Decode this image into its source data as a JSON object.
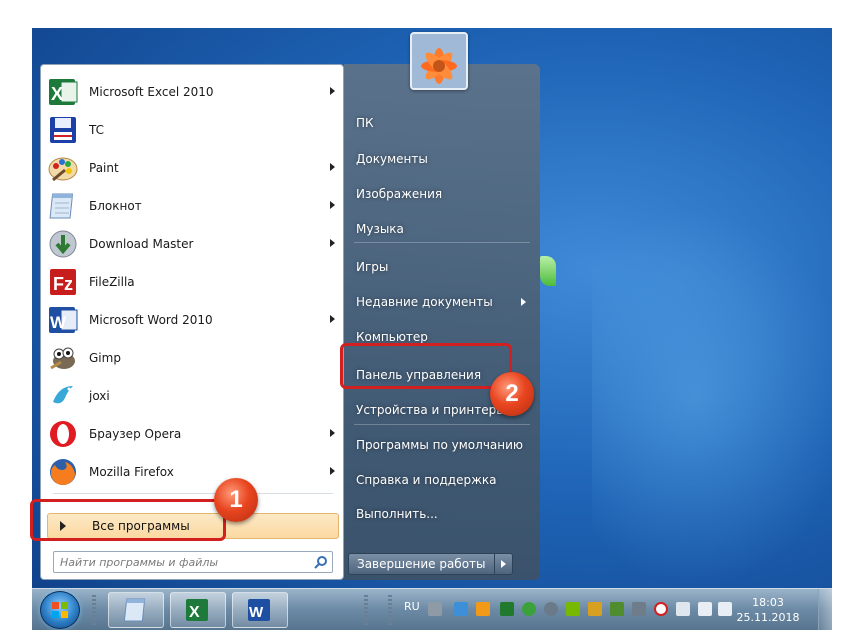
{
  "programs": [
    {
      "label": "Microsoft Excel 2010",
      "icon": "excel-icon",
      "has_submenu": true
    },
    {
      "label": "TC",
      "icon": "total-commander-icon",
      "has_submenu": false
    },
    {
      "label": "Paint",
      "icon": "paint-icon",
      "has_submenu": true
    },
    {
      "label": "Блокнот",
      "icon": "notepad-icon",
      "has_submenu": true
    },
    {
      "label": "Download Master",
      "icon": "download-master-icon",
      "has_submenu": true
    },
    {
      "label": "FileZilla",
      "icon": "filezilla-icon",
      "has_submenu": false
    },
    {
      "label": "Microsoft Word 2010",
      "icon": "word-icon",
      "has_submenu": true
    },
    {
      "label": "Gimp",
      "icon": "gimp-icon",
      "has_submenu": false
    },
    {
      "label": "joxi",
      "icon": "joxi-icon",
      "has_submenu": false
    },
    {
      "label": "Браузер Opera",
      "icon": "opera-icon",
      "has_submenu": true
    },
    {
      "label": "Mozilla Firefox",
      "icon": "firefox-icon",
      "has_submenu": true
    }
  ],
  "all_programs": {
    "label": "Все программы"
  },
  "search": {
    "placeholder": "Найти программы и файлы"
  },
  "right_panel": {
    "items": [
      {
        "label": "ПК"
      },
      {
        "label": "Документы"
      },
      {
        "label": "Изображения"
      },
      {
        "label": "Музыка"
      },
      {
        "label": "Игры"
      },
      {
        "label": "Недавние документы",
        "has_submenu": true
      },
      {
        "label": "Компьютер"
      },
      {
        "label": "Панель управления"
      },
      {
        "label": "Устройства и принтеры"
      },
      {
        "label": "Программы по умолчанию"
      },
      {
        "label": "Справка и поддержка"
      },
      {
        "label": "Выполнить..."
      }
    ],
    "shutdown_label": "Завершение работы"
  },
  "annotations": [
    {
      "number": "1",
      "target": "Все программы"
    },
    {
      "number": "2",
      "target": "Панель управления"
    }
  ],
  "taskbar": {
    "pinned": [
      "notepad-icon",
      "excel-icon",
      "word-icon"
    ],
    "language": "RU",
    "time": "18:03",
    "date": "25.11.2018"
  },
  "colors": {
    "highlight_red": "#d21f1f",
    "badge_orange": "#e8451f",
    "desktop_blue": "#1e63b5"
  }
}
